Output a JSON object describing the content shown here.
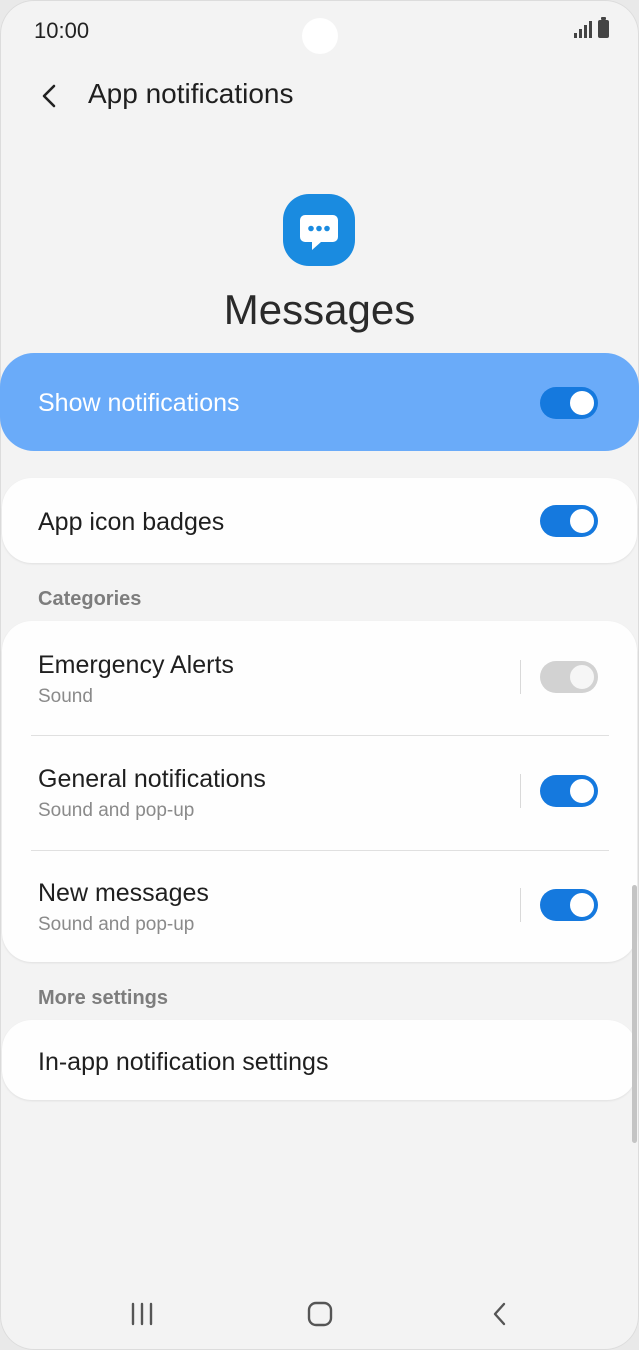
{
  "status_bar": {
    "time": "10:00"
  },
  "header": {
    "title": "App notifications"
  },
  "app": {
    "name": "Messages",
    "icon": "messages-chat-bubble-icon",
    "icon_color": "#1a8be0"
  },
  "show_notifications": {
    "label": "Show notifications",
    "enabled": true
  },
  "app_icon_badges": {
    "label": "App icon badges",
    "enabled": true
  },
  "categories": {
    "header": "Categories",
    "items": [
      {
        "title": "Emergency Alerts",
        "subtitle": "Sound",
        "enabled": true,
        "disabled": true
      },
      {
        "title": "General notifications",
        "subtitle": "Sound and pop-up",
        "enabled": true,
        "disabled": false
      },
      {
        "title": "New messages",
        "subtitle": "Sound and pop-up",
        "enabled": true,
        "disabled": false
      }
    ]
  },
  "more_settings": {
    "header": "More settings",
    "items": [
      {
        "title": "In-app notification settings"
      }
    ]
  },
  "colors": {
    "accent": "#1579de",
    "highlight": "#6aabf9",
    "background": "#f3f3f3"
  },
  "nav_bar": {
    "icons": [
      "recent-apps-icon",
      "home-icon",
      "back-icon"
    ]
  }
}
